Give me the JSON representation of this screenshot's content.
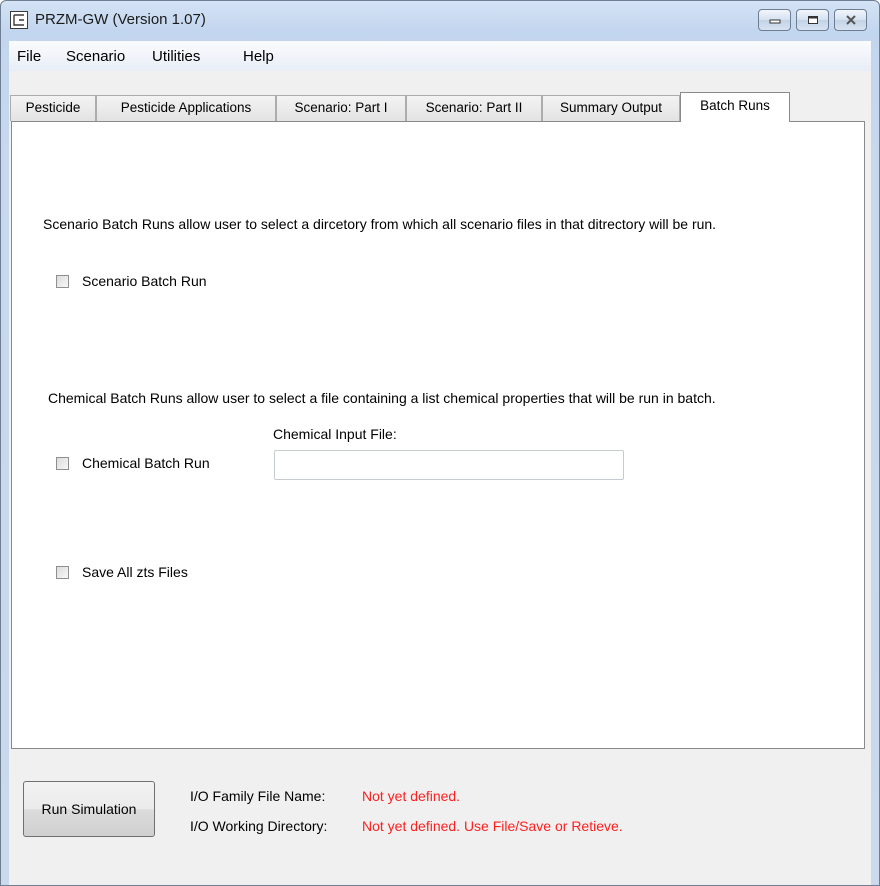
{
  "window": {
    "title": "PRZM-GW (Version 1.07)",
    "controls": [
      "minimize-icon",
      "maximize-icon",
      "close-icon"
    ]
  },
  "menu": {
    "items": [
      "File",
      "Scenario",
      "Utilities",
      "Help"
    ]
  },
  "tabs": [
    {
      "label": "Pesticide"
    },
    {
      "label": "Pesticide Applications"
    },
    {
      "label": "Scenario:  Part I"
    },
    {
      "label": "Scenario: Part II"
    },
    {
      "label": "Summary Output"
    },
    {
      "label": "Batch Runs",
      "active": true
    }
  ],
  "batch": {
    "scenario_description": "Scenario Batch Runs allow user to select a dircetory from which all scenario files in that ditrectory will be run.",
    "scenario_checkbox_label": "Scenario Batch Run",
    "scenario_checked": false,
    "chemical_description": "Chemical Batch Runs allow user to select a  file containing a list chemical properties that will be run in batch.",
    "chemical_checkbox_label": "Chemical Batch Run",
    "chemical_checked": false,
    "chemical_input_label": "Chemical Input File:",
    "chemical_input_value": "",
    "save_zts_label": "Save All zts Files",
    "save_zts_checked": false
  },
  "footer": {
    "run_button": "Run Simulation",
    "family_file_label": "I/O Family File Name:",
    "family_file_value": "Not yet defined.",
    "working_dir_label": "I/O Working Directory:",
    "working_dir_value": "Not yet defined. Use File/Save or Retieve."
  },
  "colors": {
    "status_value": "#ff1f1f",
    "title_bar": "#c3d6ef"
  }
}
